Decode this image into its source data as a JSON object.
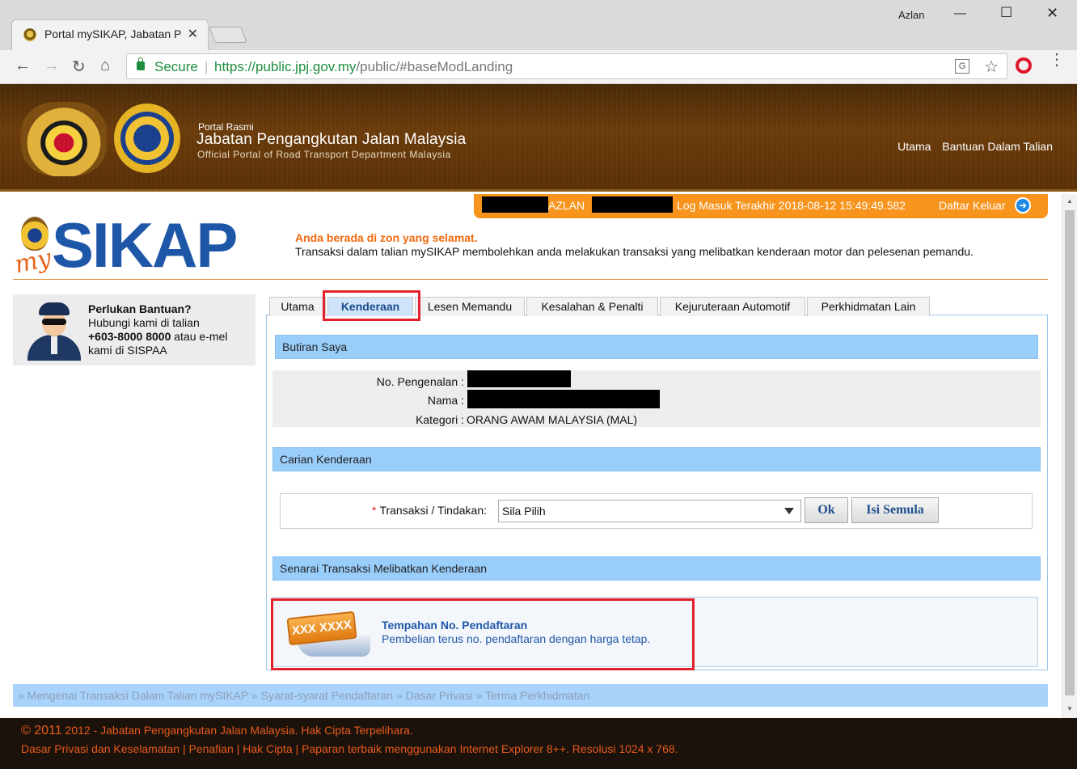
{
  "browser": {
    "tab_title": "Portal mySIKAP, Jabatan P",
    "user": "Azlan",
    "secure_label": "Secure",
    "url_host": "https://public.jpj.gov.my",
    "url_rest": "/public/#baseModLanding"
  },
  "header": {
    "portal_rasmi": "Portal Rasmi",
    "agency_name": "Jabatan Pengangkutan Jalan Malaysia",
    "agency_en": "Official Portal of Road Transport Department Malaysia",
    "nav": [
      "Utama",
      "Bantuan Dalam Talian"
    ]
  },
  "login": {
    "name": "AZLAN",
    "last_login": "Log Masuk Terakhir 2018-08-12 15:49:49.582",
    "logout": "Daftar Keluar"
  },
  "logo": {
    "my": "my",
    "sikap": "SIKAP"
  },
  "notice": {
    "title": "Anda berada di zon yang selamat.",
    "desc": "Transaksi dalam talian mySIKAP membolehkan anda melakukan transaksi yang melibatkan kenderaan motor dan pelesenan pemandu."
  },
  "help": {
    "title": "Perlukan Bantuan?",
    "line1": "Hubungi kami di talian",
    "phone": "+603-8000 8000",
    "line2_rest": " atau e-mel",
    "line3": "kami di SISPAA"
  },
  "tabs": [
    "Utama",
    "Kenderaan",
    "Lesen Memandu",
    "Kesalahan & Penalti",
    "Kejuruteraan Automotif",
    "Perkhidmatan Lain"
  ],
  "butiran": {
    "header": "Butiran Saya",
    "id_label": "No. Pengenalan :",
    "name_label": "Nama :",
    "kategori_label": "Kategori :",
    "kategori_value": "ORANG AWAM MALAYSIA (MAL)"
  },
  "carian": {
    "header": "Carian Kenderaan",
    "required": "*",
    "label": "Transaksi / Tindakan:",
    "selected": "Sila Pilih",
    "ok": "Ok",
    "reset": "Isi Semula"
  },
  "senarai": {
    "header": "Senarai Transaksi Melibatkan Kenderaan",
    "plate_text": "XXX XXXX",
    "title": "Tempahan No. Pendaftaran",
    "desc": "Pembelian terus no. pendaftaran dengan harga tetap."
  },
  "footer_links": [
    "» Mengenai Transaksi Dalam Talian mySIKAP",
    " » Syarat-syarat Pendaftaran",
    " » Dasar Privasi",
    " » Terma Perkhidmatan"
  ],
  "footer": {
    "year": "© 2011",
    "copyright": " 2012 - Jabatan Pengangkutan Jalan Malaysia. Hak Cipta Terpelihara.",
    "links": [
      "Dasar Privasi dan Keselamatan",
      "Penafian",
      "Hak Cipta"
    ],
    "sep": " | ",
    "note": "Paparan terbaik menggunakan Internet Explorer 8++. Resolusi 1024 x 768."
  },
  "colors": {
    "accent_orange": "#f7941d",
    "brand_blue": "#1f57a8",
    "highlight_red": "#e3202b",
    "section_blue": "#99cdfa"
  }
}
